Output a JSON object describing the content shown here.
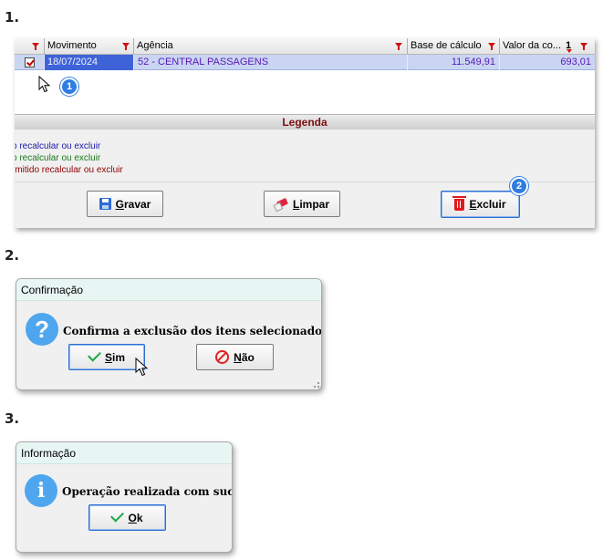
{
  "steps": {
    "one": "1.",
    "two": "2.",
    "three": "3."
  },
  "grid": {
    "columns": {
      "movimento": "Movimento",
      "agencia": "Agência",
      "base_calculo": "Base de cálculo",
      "valor": "Valor da co...",
      "sort_index": "1"
    },
    "row": {
      "date": "18/07/2024",
      "agencia": "52 - CENTRAL PASSAGENS",
      "base": "11.549,91",
      "valor": "693,01"
    }
  },
  "legend": {
    "title": "Legenda",
    "line1": "o recalcular ou excluir",
    "line2": "o recalcular ou excluir",
    "line3": "rmitido recalcular ou excluir"
  },
  "buttons": {
    "gravar": "Gravar",
    "limpar": "Limpar",
    "excluir": "Excluir"
  },
  "badges": {
    "b1": "1",
    "b2": "2"
  },
  "confirm_dialog": {
    "title": "Confirmação",
    "message": "Confirma a exclusão dos itens selecionado?",
    "yes": "Sim",
    "no": "Não",
    "icon": "?"
  },
  "info_dialog": {
    "title": "Informação",
    "message": "Operação realizada com sucesso.",
    "ok": "Ok",
    "icon": "i"
  },
  "colors": {
    "selection": "#3e63d8",
    "row_highlight": "#c9d5f2",
    "legend_title": "#7d0d0d",
    "legend_blue": "#1a1aa8",
    "legend_green": "#1a7a1a",
    "legend_red": "#8b0000",
    "badge": "#2f7de0"
  }
}
